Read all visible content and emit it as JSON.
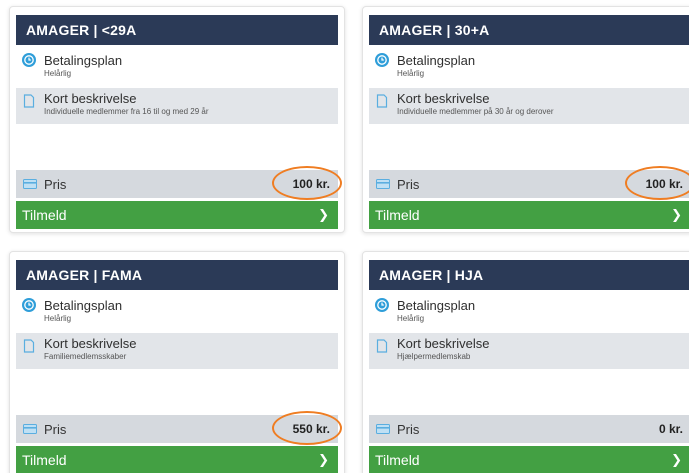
{
  "cards": [
    {
      "title": "AMAGER | <29A",
      "plan_title": "Betalingsplan",
      "plan_value": "Helårlig",
      "desc_title": "Kort beskrivelse",
      "desc_value": "Individuelle medlemmer fra 16 til og med 29 år",
      "price_label": "Pris",
      "price_value": "100 kr.",
      "price_highlighted": true,
      "button_label": "Tilmeld"
    },
    {
      "title": "AMAGER | 30+A",
      "plan_title": "Betalingsplan",
      "plan_value": "Helårlig",
      "desc_title": "Kort beskrivelse",
      "desc_value": "Individuelle medlemmer på 30 år og derover",
      "price_label": "Pris",
      "price_value": "100 kr.",
      "price_highlighted": true,
      "button_label": "Tilmeld"
    },
    {
      "title": "AMAGER | FAMA",
      "plan_title": "Betalingsplan",
      "plan_value": "Helårlig",
      "desc_title": "Kort beskrivelse",
      "desc_value": "Familiemedlemsskaber",
      "price_label": "Pris",
      "price_value": "550 kr.",
      "price_highlighted": true,
      "button_label": "Tilmeld"
    },
    {
      "title": "AMAGER | HJA",
      "plan_title": "Betalingsplan",
      "plan_value": "Helårlig",
      "desc_title": "Kort beskrivelse",
      "desc_value": "Hjælpermedlemskab",
      "price_label": "Pris",
      "price_value": "0 kr.",
      "price_highlighted": false,
      "button_label": "Tilmeld"
    }
  ],
  "colors": {
    "header": "#2b3a57",
    "button": "#43a043",
    "price_row": "#d5d9de",
    "desc_row": "#e2e5e9",
    "icon_blue": "#2f9ed9",
    "highlight_circle": "#ef7d22"
  },
  "icons": {
    "plan": "clock-icon",
    "desc": "document-icon",
    "price": "credit-card-icon",
    "button": "chevron-right-icon"
  }
}
